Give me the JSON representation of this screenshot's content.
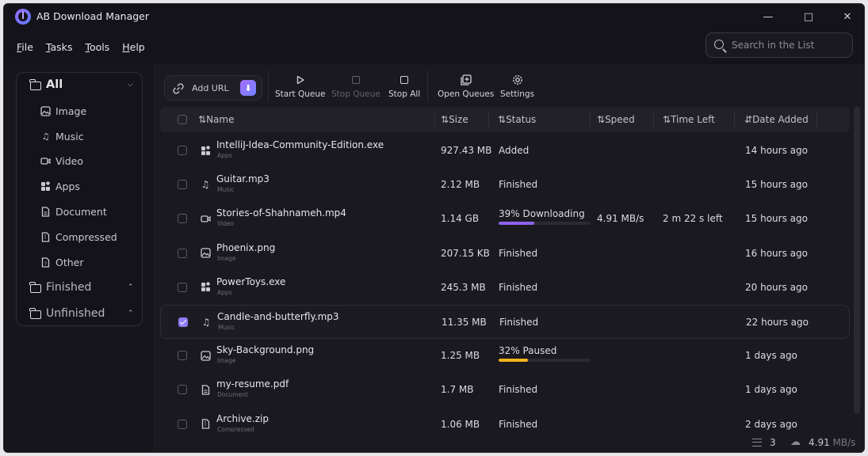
{
  "app": {
    "title": "AB Download Manager"
  },
  "menu": [
    "File",
    "Tasks",
    "Tools",
    "Help"
  ],
  "search": {
    "placeholder": "Search in the List"
  },
  "sidebar": {
    "all": "All",
    "subcategories": [
      {
        "label": "Image",
        "icon": "image-icon"
      },
      {
        "label": "Music",
        "icon": "music-icon"
      },
      {
        "label": "Video",
        "icon": "video-icon"
      },
      {
        "label": "Apps",
        "icon": "apps-icon"
      },
      {
        "label": "Document",
        "icon": "document-icon"
      },
      {
        "label": "Compressed",
        "icon": "compressed-icon"
      },
      {
        "label": "Other",
        "icon": "other-icon"
      }
    ],
    "finished": "Finished",
    "unfinished": "Unfinished"
  },
  "toolbar": {
    "add_url": "Add URL",
    "start_queue": "Start Queue",
    "stop_queue": "Stop Queue",
    "stop_all": "Stop All",
    "open_queues": "Open Queues",
    "settings": "Settings"
  },
  "table": {
    "columns": {
      "name": "Name",
      "size": "Size",
      "status": "Status",
      "speed": "Speed",
      "time_left": "Time Left",
      "date_added": "Date Added"
    },
    "rows": [
      {
        "name": "IntelliJ-Idea-Community-Edition.exe",
        "type": "Apps",
        "size": "927.43 MB",
        "status": "Added",
        "speed": "",
        "time_left": "",
        "date": "14 hours ago",
        "checked": false,
        "selected": false
      },
      {
        "name": "Guitar.mp3",
        "type": "Music",
        "size": "2.12 MB",
        "status": "Finished",
        "speed": "",
        "time_left": "",
        "date": "15 hours ago",
        "checked": false,
        "selected": false
      },
      {
        "name": "Stories-of-Shahnameh.mp4",
        "type": "Video",
        "size": "1.14 GB",
        "status": "39% Downloading",
        "progress": 0.39,
        "bar_color": "#8e63f0",
        "speed": "4.91 MB/s",
        "time_left": "2 m 22 s left",
        "date": "15 hours ago",
        "checked": false,
        "selected": false
      },
      {
        "name": "Phoenix.png",
        "type": "Image",
        "size": "207.15 KB",
        "status": "Finished",
        "speed": "",
        "time_left": "",
        "date": "16 hours ago",
        "checked": false,
        "selected": false
      },
      {
        "name": "PowerToys.exe",
        "type": "Apps",
        "size": "245.3 MB",
        "status": "Finished",
        "speed": "",
        "time_left": "",
        "date": "20 hours ago",
        "checked": false,
        "selected": false
      },
      {
        "name": "Candle-and-butterfly.mp3",
        "type": "Music",
        "size": "11.35 MB",
        "status": "Finished",
        "speed": "",
        "time_left": "",
        "date": "22 hours ago",
        "checked": true,
        "selected": true
      },
      {
        "name": "Sky-Background.png",
        "type": "Image",
        "size": "1.25 MB",
        "status": "32% Paused",
        "progress": 0.32,
        "bar_color": "#f2b41d",
        "speed": "",
        "time_left": "",
        "date": "1 days ago",
        "checked": false,
        "selected": false
      },
      {
        "name": "my-resume.pdf",
        "type": "Document",
        "size": "1.7 MB",
        "status": "Finished",
        "speed": "",
        "time_left": "",
        "date": "1 days ago",
        "checked": false,
        "selected": false
      },
      {
        "name": "Archive.zip",
        "type": "Compressed",
        "size": "1.06 MB",
        "status": "Finished",
        "speed": "",
        "time_left": "",
        "date": "2 days ago",
        "checked": false,
        "selected": false
      }
    ]
  },
  "statusbar": {
    "count": "3",
    "speed_value": "4.91",
    "speed_unit": "MB/s"
  },
  "colors": {
    "accent": "#8f7cf6",
    "background": "#141319",
    "panel": "#1a1920"
  }
}
